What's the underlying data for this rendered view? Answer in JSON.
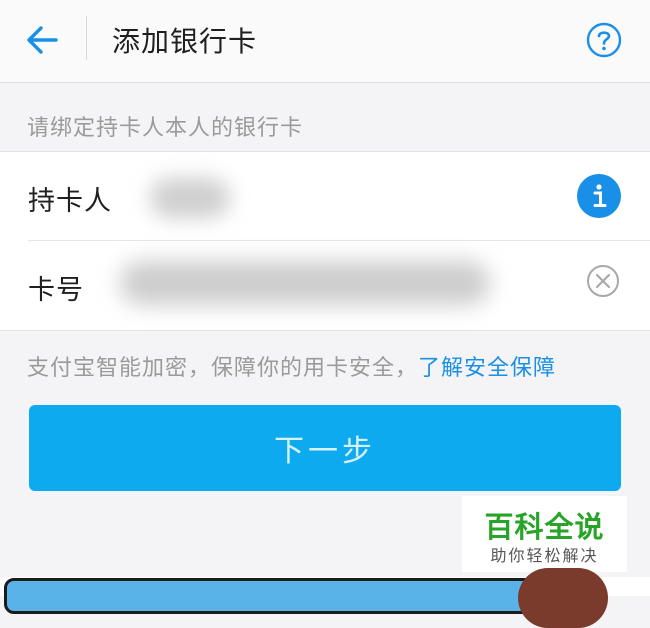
{
  "nav": {
    "title": "添加银行卡",
    "back_icon": "arrow-left-icon",
    "help_icon": "question-circle-icon",
    "accent": "#1a8fe8"
  },
  "form": {
    "hint": "请绑定持卡人本人的银行卡",
    "holder_label": "持卡人",
    "holder_info_icon": "info-icon",
    "card_label": "卡号",
    "card_clear_icon": "clear-circle-icon"
  },
  "security": {
    "text": "支付宝智能加密，保障你的用卡安全，",
    "link": "了解安全保障"
  },
  "actions": {
    "next_label": "下一步",
    "button_color": "#0eaaef"
  },
  "watermark": {
    "title": "百科全说",
    "subtitle": "助你轻松解决",
    "color": "#28a428"
  }
}
